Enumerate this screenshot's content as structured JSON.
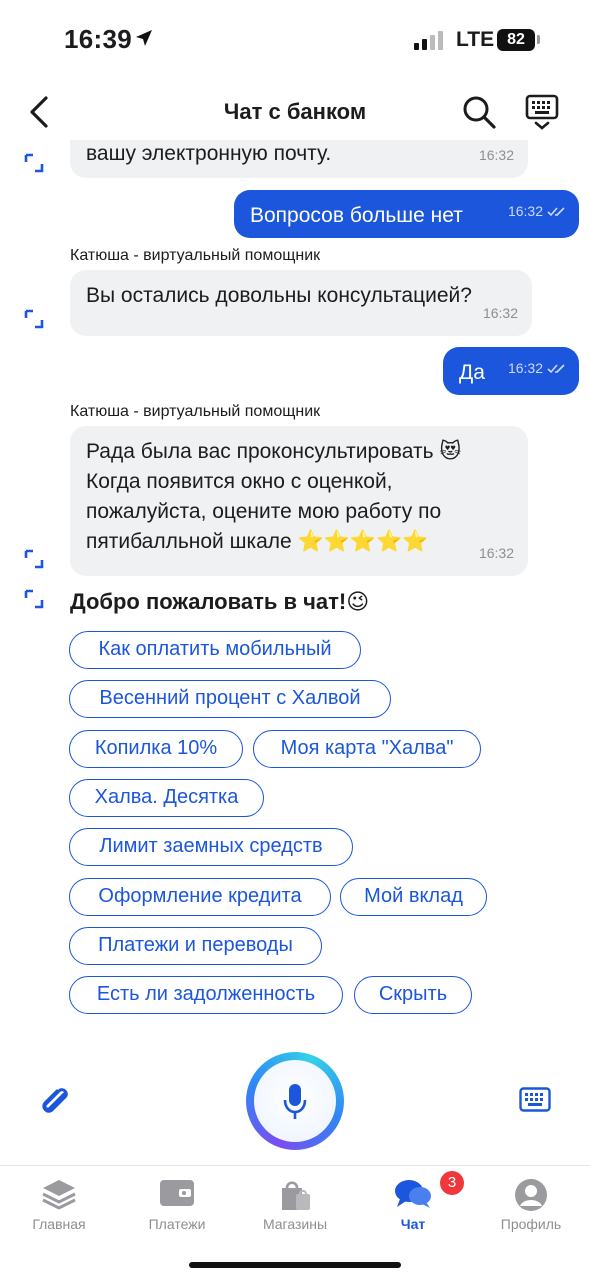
{
  "status_bar": {
    "time": "16:39",
    "network": "LTE",
    "battery": "82"
  },
  "header": {
    "title": "Чат с банком",
    "back_icon": "chevron-left-icon",
    "search_icon": "search-icon",
    "keyboard_icon": "keyboard-icon"
  },
  "messages": [
    {
      "from": "bot",
      "text": "вашу электронную почту.",
      "time": "16:32"
    },
    {
      "from": "user",
      "text": "Вопросов больше нет",
      "time": "16:32"
    },
    {
      "from": "bot",
      "sender": "Катюша - виртуальный помощник",
      "text": "Вы остались довольны консультацией?",
      "time": "16:32"
    },
    {
      "from": "user",
      "text": "Да",
      "time": "16:32"
    },
    {
      "from": "bot",
      "sender": "Катюша - виртуальный помощник",
      "lines": [
        "Рада была вас проконсультировать 😻",
        "Когда появится окно с оценкой,",
        "пожалуйста, оцените мою работу по",
        "пятибалльной шкале ⭐⭐⭐⭐⭐"
      ],
      "time": "16:32"
    }
  ],
  "welcome": "Добро пожаловать в чат!😉",
  "quick_replies": [
    "Как оплатить мобильный",
    "Весенний процент с Халвой",
    "Копилка 10%",
    "Моя карта \"Халва\"",
    "Халва. Десятка",
    "Лимит заемных средств",
    "Оформление кредита",
    "Мой вклад",
    "Платежи и переводы",
    "Есть ли задолженность",
    "Скрыть"
  ],
  "input_bar": {
    "attach_icon": "paperclip-icon",
    "mic_icon": "microphone-icon",
    "keyboard_icon": "keyboard-icon"
  },
  "tabs": [
    {
      "label": "Главная",
      "icon": "layers-icon",
      "active": false
    },
    {
      "label": "Платежи",
      "icon": "wallet-icon",
      "active": false
    },
    {
      "label": "Магазины",
      "icon": "shopping-bag-icon",
      "active": false
    },
    {
      "label": "Чат",
      "icon": "chat-bubbles-icon",
      "active": true,
      "badge": "3"
    },
    {
      "label": "Профиль",
      "icon": "profile-icon",
      "active": false
    }
  ],
  "colors": {
    "accent": "#1b56dd",
    "bubble_in": "#f0f1f3",
    "badge": "#f0383c",
    "inactive": "#8e8e93"
  }
}
